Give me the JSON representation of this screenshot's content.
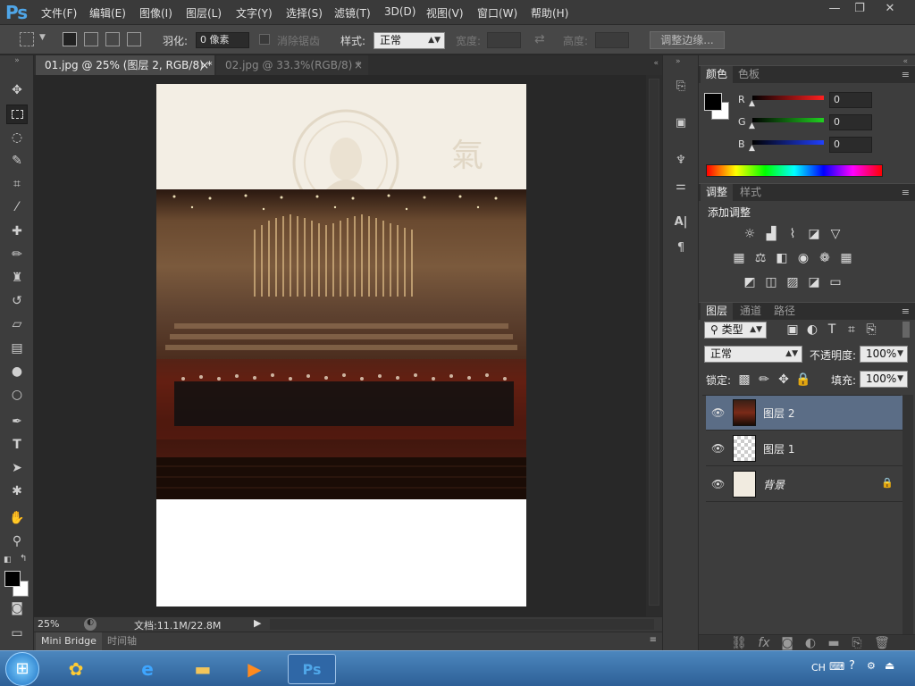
{
  "menubar": {
    "logo": "Ps",
    "items": [
      "文件(F)",
      "编辑(E)",
      "图像(I)",
      "图层(L)",
      "文字(Y)",
      "选择(S)",
      "滤镜(T)",
      "3D(D)",
      "视图(V)",
      "窗口(W)",
      "帮助(H)"
    ],
    "window_controls": [
      "—",
      "❐",
      "✕"
    ]
  },
  "options": {
    "feather_label": "羽化:",
    "feather_value": "0 像素",
    "antialias_label": "消除锯齿",
    "style_label": "样式:",
    "style_value": "正常",
    "width_label": "宽度:",
    "height_label": "高度:",
    "refine_button": "调整边缘..."
  },
  "doc_tabs": [
    {
      "label": "01.jpg @ 25% (图层 2, RGB/8) *",
      "close": "×"
    },
    {
      "label": "02.jpg @ 33.3%(RGB/8) *",
      "close": "×"
    }
  ],
  "statusbar": {
    "zoom": "25%",
    "doc_info": "文档:11.1M/22.8M"
  },
  "bottom_tabs": [
    "Mini Bridge",
    "时间轴"
  ],
  "color_panel": {
    "tabs": [
      "颜色",
      "色板"
    ],
    "channels": [
      {
        "label": "R",
        "value": "0",
        "color": "#ff2020"
      },
      {
        "label": "G",
        "value": "0",
        "color": "#20d020"
      },
      {
        "label": "B",
        "value": "0",
        "color": "#2040ff"
      }
    ]
  },
  "adjust_panel": {
    "tabs": [
      "调整",
      "样式"
    ],
    "title": "添加调整"
  },
  "layers_panel": {
    "tabs": [
      "图层",
      "通道",
      "路径"
    ],
    "filter_value": "类型",
    "blend_mode": "正常",
    "opacity_label": "不透明度:",
    "opacity_value": "100%",
    "lock_label": "锁定:",
    "fill_label": "填充:",
    "fill_value": "100%",
    "layers": [
      {
        "name": "图层 2",
        "selected": true
      },
      {
        "name": "图层 1",
        "selected": false
      },
      {
        "name": "背景",
        "selected": false
      }
    ]
  },
  "taskbar": {
    "lang": "CH"
  },
  "colors": {
    "accent": "#4fa6e8",
    "selected_layer": "#5b6d86",
    "panel_bg": "#3d3d3d",
    "canvas_bg": "#282828"
  }
}
